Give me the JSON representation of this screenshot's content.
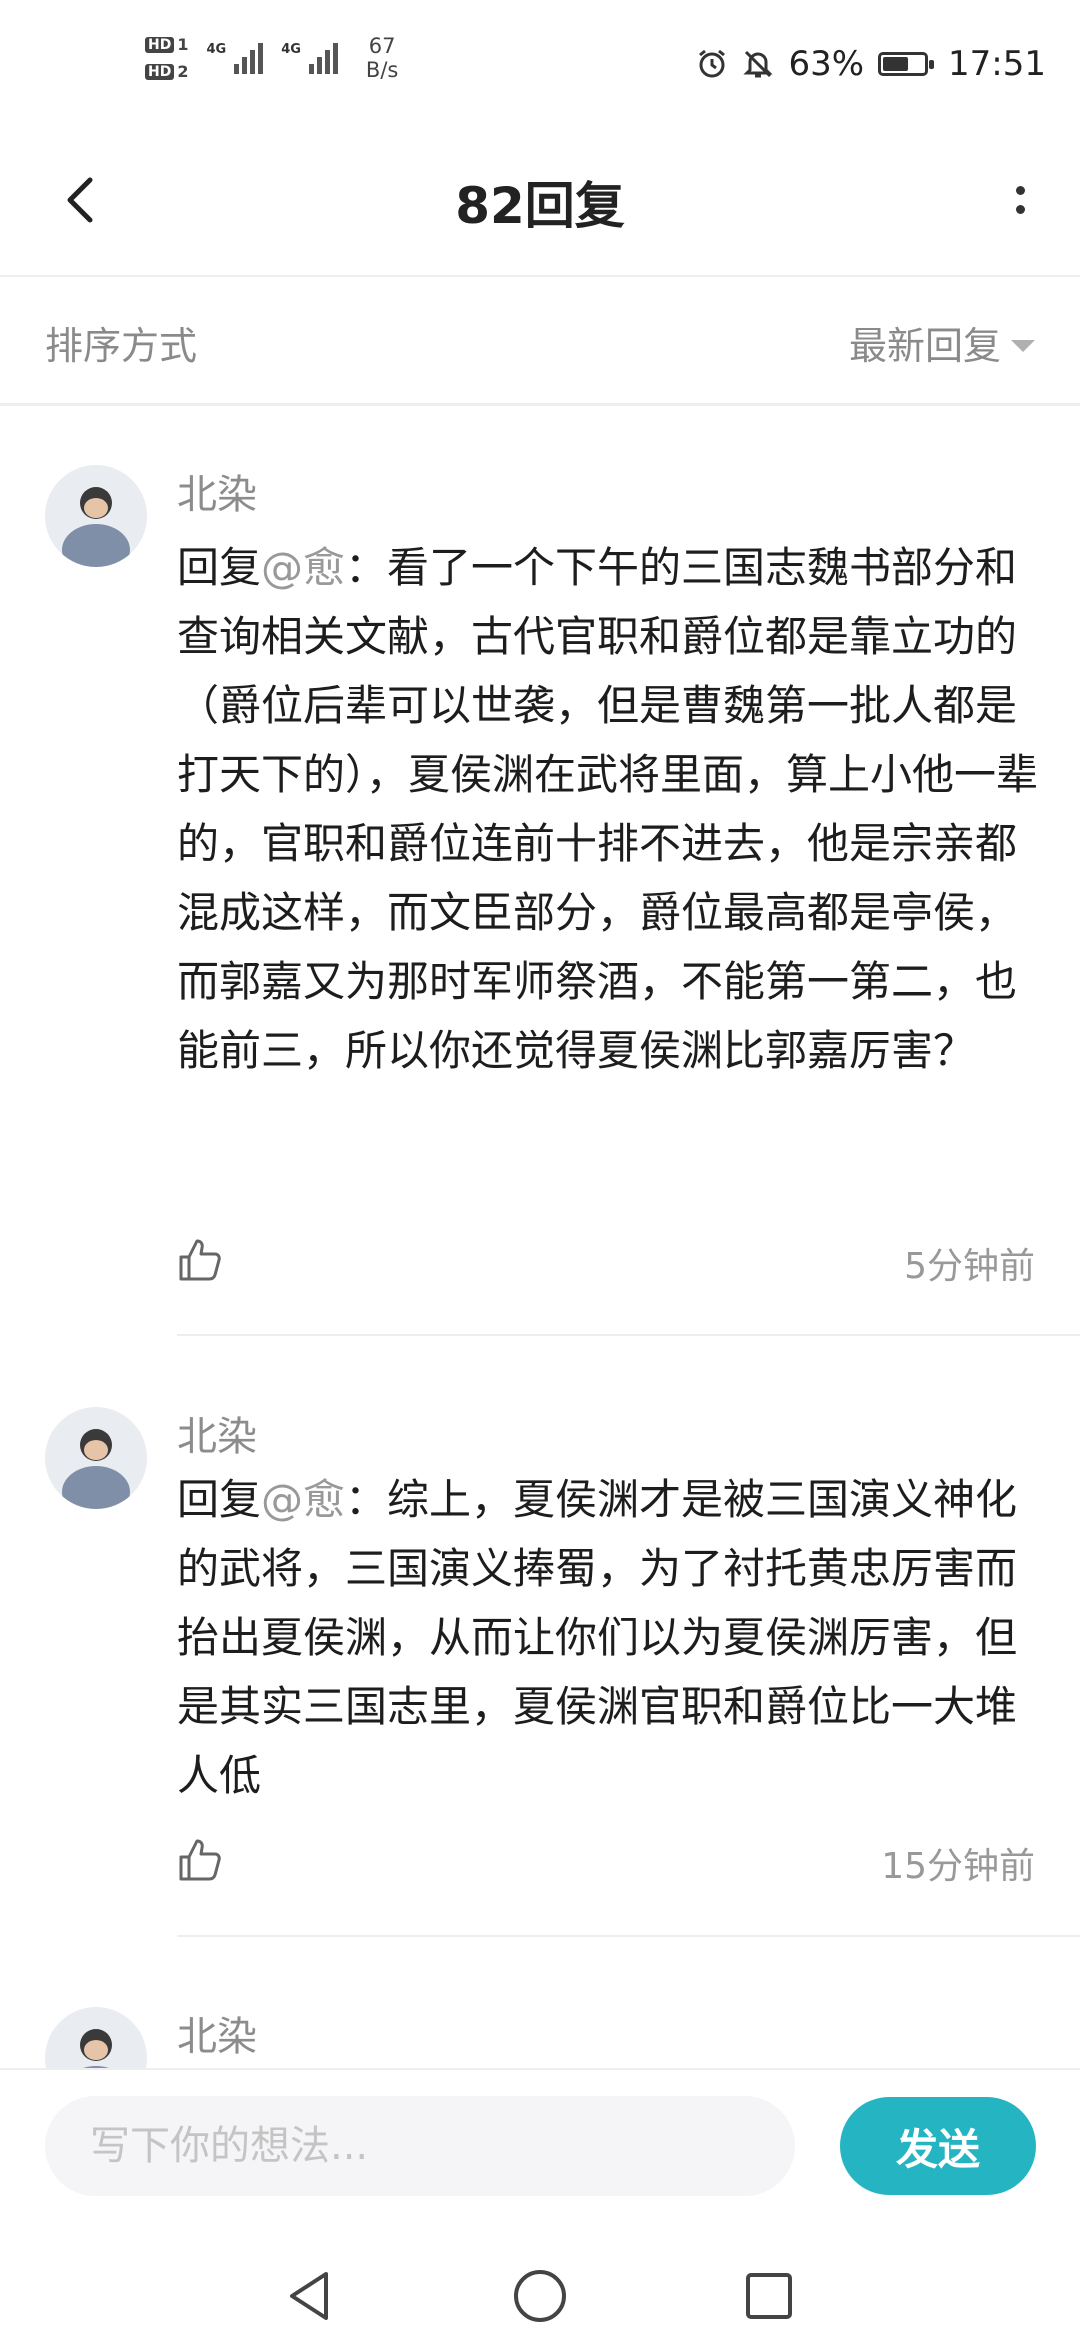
{
  "status_bar": {
    "hd1": "HD",
    "hd1_sub": "1",
    "hd2": "HD",
    "hd2_sub": "2",
    "net1": "4G",
    "net2": "4G",
    "speed_value": "67",
    "speed_unit": "B/s",
    "battery_percent": "63%",
    "battery_level": 0.63,
    "time": "17:51"
  },
  "header": {
    "title": "82回复"
  },
  "sort": {
    "label": "排序方式",
    "selected": "最新回复"
  },
  "replies": [
    {
      "username": "北染",
      "prefix": "回复",
      "mention": "@愈",
      "text": "：看了一个下午的三国志魏书部分和查询相关文献，古代官职和爵位都是靠立功的（爵位后辈可以世袭，但是曹魏第一批人都是打天下的），夏侯渊在武将里面，算上小他一辈的，官职和爵位连前十排不进去，他是宗亲都混成这样，而文臣部分，爵位最高都是亭侯，而郭嘉又为那时军师祭酒，不能第一第二，也能前三，所以你还觉得夏侯渊比郭嘉厉害？",
      "time": "5分钟前"
    },
    {
      "username": "北染",
      "prefix": "回复",
      "mention": "@愈",
      "text": "：综上，夏侯渊才是被三国演义神化的武将，三国演义捧蜀，为了衬托黄忠厉害而抬出夏侯渊，从而让你们以为夏侯渊厉害，但是其实三国志里，夏侯渊官职和爵位比一大堆人低",
      "time": "15分钟前"
    },
    {
      "username": "北染"
    }
  ],
  "input": {
    "placeholder": "写下你的想法...",
    "send_label": "发送"
  },
  "colors": {
    "accent": "#25b5c2",
    "muted": "#999999"
  },
  "icons": {
    "back": "chevron-left-icon",
    "more": "more-vertical-icon",
    "like": "thumbs-up-icon",
    "nav_back": "triangle-back-icon",
    "nav_home": "circle-home-icon",
    "nav_recent": "square-recent-icon"
  }
}
